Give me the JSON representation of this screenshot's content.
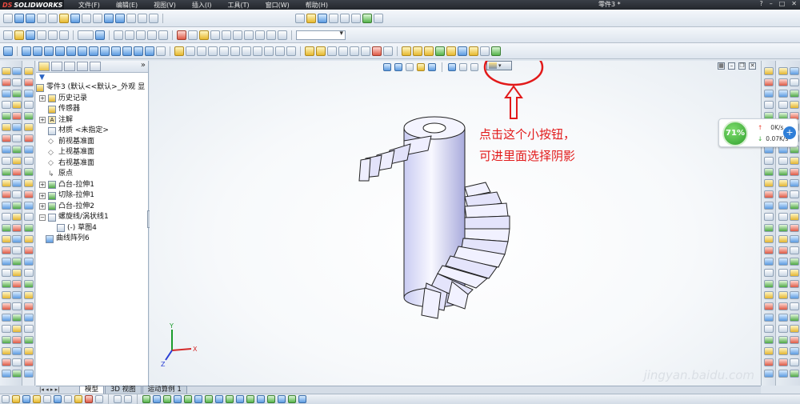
{
  "app": {
    "logo_text": "SOLIDWORKS",
    "logo_prefix": "DS",
    "document_title": "零件3 *",
    "menus": [
      "文件(F)",
      "编辑(E)",
      "视图(V)",
      "插入(I)",
      "工具(T)",
      "窗口(W)",
      "帮助(H)"
    ]
  },
  "feature_tree": {
    "root": "零件3  (默认<<默认>_外观 显",
    "items": [
      {
        "label": "历史记录",
        "expandable": true,
        "icon": "history-icon"
      },
      {
        "label": "传感器",
        "expandable": false,
        "icon": "sensor-icon"
      },
      {
        "label": "注解",
        "expandable": true,
        "icon": "annotation-icon"
      },
      {
        "label": "材质 <未指定>",
        "expandable": false,
        "icon": "material-icon"
      },
      {
        "label": "前视基准面",
        "expandable": false,
        "icon": "plane-icon"
      },
      {
        "label": "上视基准面",
        "expandable": false,
        "icon": "plane-icon"
      },
      {
        "label": "右视基准面",
        "expandable": false,
        "icon": "plane-icon"
      },
      {
        "label": "原点",
        "expandable": false,
        "icon": "origin-icon"
      },
      {
        "label": "凸台-拉伸1",
        "expandable": true,
        "icon": "boss-extrude-icon"
      },
      {
        "label": "切除-拉伸1",
        "expandable": true,
        "icon": "cut-extrude-icon"
      },
      {
        "label": "凸台-拉伸2",
        "expandable": true,
        "icon": "boss-extrude-icon"
      },
      {
        "label": "螺旋线/涡状线1",
        "expandable": true,
        "expanded": true,
        "icon": "helix-icon"
      },
      {
        "label": "(-) 草图4",
        "expandable": false,
        "child": true,
        "icon": "sketch-icon"
      },
      {
        "label": "曲线阵列6",
        "expandable": false,
        "icon": "curve-pattern-icon"
      }
    ],
    "filter_glyph": "▼",
    "expand_glyph": "»"
  },
  "viewport": {
    "annotation_line1": "点击这个小按钮，",
    "annotation_line2": "可进里面选择阴影",
    "watermark": "jingyan.baidu.com",
    "triad": {
      "x": "X",
      "y": "Y",
      "z": "Z"
    }
  },
  "network_widget": {
    "percent": "71%",
    "upload": "0K/s",
    "download": "0.07K/s",
    "plus": "+"
  },
  "bottom_tabs": {
    "nav": "|◂ ◂ ▸ ▸|",
    "tabs": [
      "模型",
      "3D 视图",
      "运动算例 1"
    ]
  },
  "colors": {
    "annotation_red": "#e21a1a",
    "accent_blue": "#2f7fd8",
    "network_green": "#2f9f2c"
  }
}
